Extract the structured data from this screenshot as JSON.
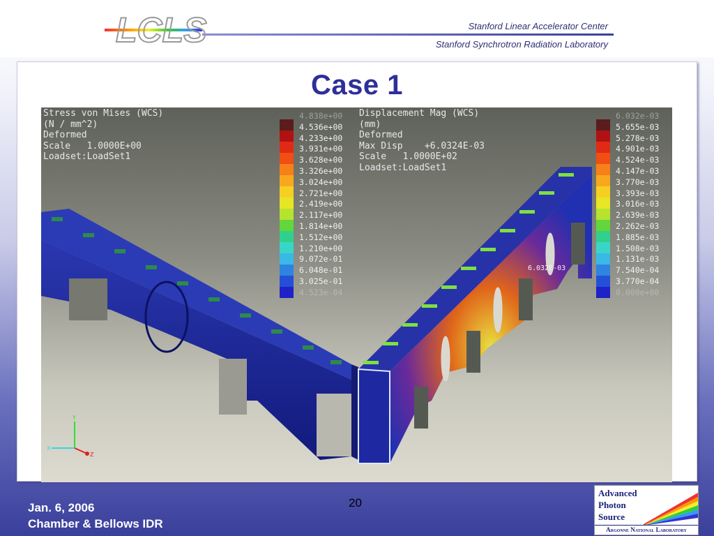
{
  "header": {
    "logo_text": "LCLS",
    "org_line_1": "Stanford Linear Accelerator Center",
    "org_line_2": "Stanford Synchrotron Radiation Laboratory"
  },
  "slide": {
    "title": "Case 1",
    "page_number": "20"
  },
  "stress_panel": {
    "lines": [
      "Stress von Mises (WCS)",
      "(N / mm^2)",
      "Deformed",
      "Scale   1.0000E+00",
      "Loadset:LoadSet1"
    ],
    "legend": [
      "4.838e+00",
      "4.536e+00",
      "4.233e+00",
      "3.931e+00",
      "3.628e+00",
      "3.326e+00",
      "3.024e+00",
      "2.721e+00",
      "2.419e+00",
      "2.117e+00",
      "1.814e+00",
      "1.512e+00",
      "1.210e+00",
      "9.072e-01",
      "6.048e-01",
      "3.025e-01",
      "4.523e-04"
    ]
  },
  "displacement_panel": {
    "lines": [
      "Displacement Mag (WCS)",
      "(mm)",
      "Deformed",
      "Max Disp    +6.0324E-03",
      "Scale   1.0000E+02",
      "Loadset:LoadSet1"
    ],
    "legend": [
      "6.032e-03",
      "5.655e-03",
      "5.278e-03",
      "4.901e-03",
      "4.524e-03",
      "4.147e-03",
      "3.770e-03",
      "3.393e-03",
      "3.016e-03",
      "2.639e-03",
      "2.262e-03",
      "1.885e-03",
      "1.508e-03",
      "1.131e-03",
      "7.540e-04",
      "3.770e-04",
      "0.000e+00"
    ],
    "max_marker": "6.032E-03"
  },
  "legend_colors": [
    "#5a1c1c",
    "#b01212",
    "#e02a16",
    "#f04e12",
    "#f7801a",
    "#f9a81e",
    "#f6cf22",
    "#e6e625",
    "#b5e32e",
    "#62d63a",
    "#30d08c",
    "#39d6c8",
    "#3ab8e6",
    "#2e84e0",
    "#2450d8",
    "#1f22c6"
  ],
  "axis_labels": {
    "y": "Y",
    "x": "X",
    "z": "Z"
  },
  "footer": {
    "date": "Jan. 6, 2006",
    "event": "Chamber & Bellows IDR",
    "aps_lines": [
      "Advanced",
      "Photon",
      "Source"
    ],
    "aps_bottom": "Argonne National Laboratory"
  }
}
